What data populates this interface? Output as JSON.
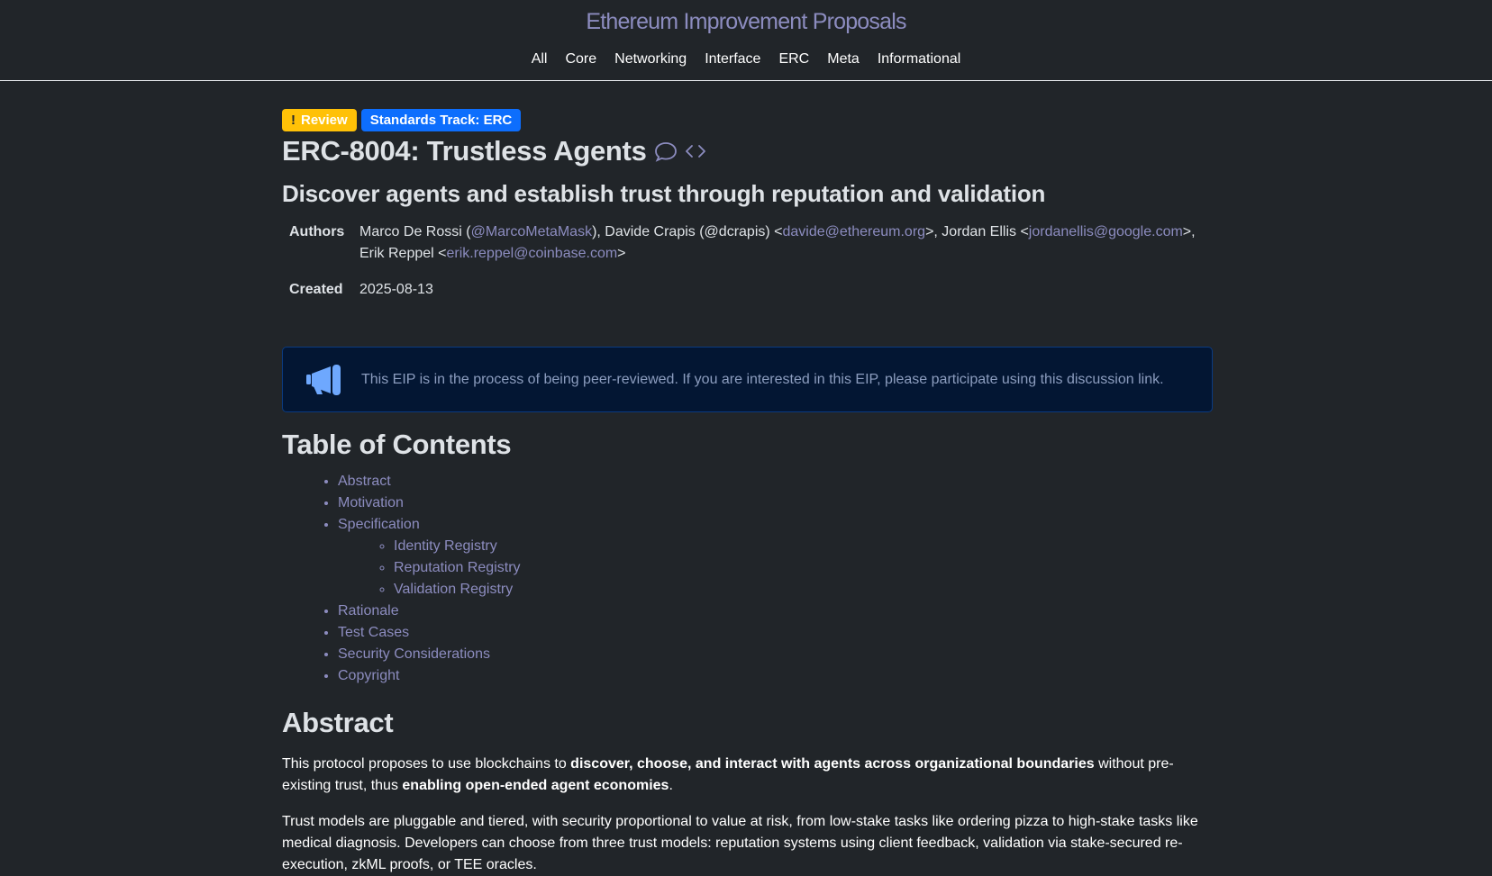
{
  "header": {
    "site_title": "Ethereum Improvement Proposals",
    "nav": [
      "All",
      "Core",
      "Networking",
      "Interface",
      "ERC",
      "Meta",
      "Informational"
    ]
  },
  "badges": {
    "status_icon": "!",
    "status": "Review",
    "track": "Standards Track: ERC"
  },
  "title": "ERC-8004: Trustless Agents",
  "icons": {
    "discussion": "comment-icon",
    "source": "code-icon",
    "callout": "megaphone-icon"
  },
  "subtitle": "Discover agents and establish trust through reputation and validation",
  "meta": {
    "authors_label": "Authors",
    "authors": [
      {
        "pre": "Marco De Rossi (",
        "link": "@MarcoMetaMask",
        "post": "), "
      },
      {
        "pre": "Davide Crapis (@dcrapis) <",
        "link": "davide@ethereum.org",
        "post": ">, "
      },
      {
        "pre": "Jordan Ellis <",
        "link": "jordanellis@google.com",
        "post": ">, "
      },
      {
        "pre": "Erik Reppel <",
        "link": "erik.reppel@coinbase.com",
        "post": ">"
      }
    ],
    "created_label": "Created",
    "created": "2025-08-13"
  },
  "callout": {
    "text": "This EIP is in the process of being peer-reviewed. If you are interested in this EIP, please participate using this discussion link."
  },
  "toc": {
    "title": "Table of Contents",
    "items": [
      "Abstract",
      "Motivation",
      "Specification"
    ],
    "sub_items": [
      "Identity Registry",
      "Reputation Registry",
      "Validation Registry"
    ],
    "items_after": [
      "Rationale",
      "Test Cases",
      "Security Considerations",
      "Copyright"
    ]
  },
  "abstract": {
    "title": "Abstract",
    "p1_a": "This protocol proposes to use blockchains to ",
    "p1_b": "discover, choose, and interact with agents across organizational boundaries",
    "p1_c": " without pre-existing trust, thus ",
    "p1_d": "enabling open-ended agent economies",
    "p1_e": ".",
    "p2": "Trust models are pluggable and tiered, with security proportional to value at risk, from low-stake tasks like ordering pizza to high-stake tasks like medical diagnosis. Developers can choose from three trust models: reputation systems using client feedback, validation via stake-secured re-execution, zkML proofs, or TEE oracles."
  }
}
